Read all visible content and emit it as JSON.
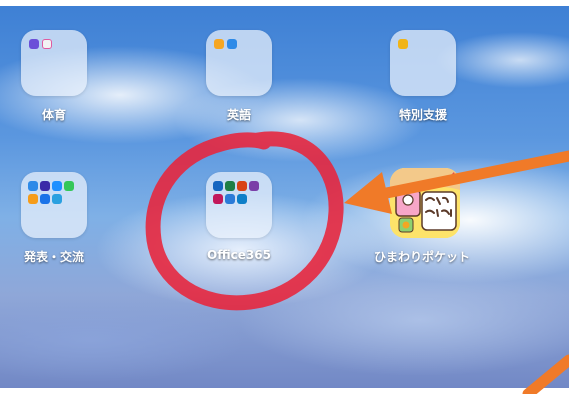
{
  "home_screen": {
    "apps": [
      {
        "label": "体育",
        "kind": "folder"
      },
      {
        "label": "英語",
        "kind": "folder"
      },
      {
        "label": "特別支援",
        "kind": "folder"
      },
      {
        "label": "発表・交流",
        "kind": "folder"
      },
      {
        "label": "Office365",
        "kind": "folder"
      },
      {
        "label": "ひまわりポケット",
        "kind": "app"
      }
    ]
  },
  "app_icon": {
    "himawari_logo_text": "ひまわりポケット"
  },
  "annotations": {
    "circle_color": "#e8233a",
    "arrow_color": "#f07a28"
  }
}
